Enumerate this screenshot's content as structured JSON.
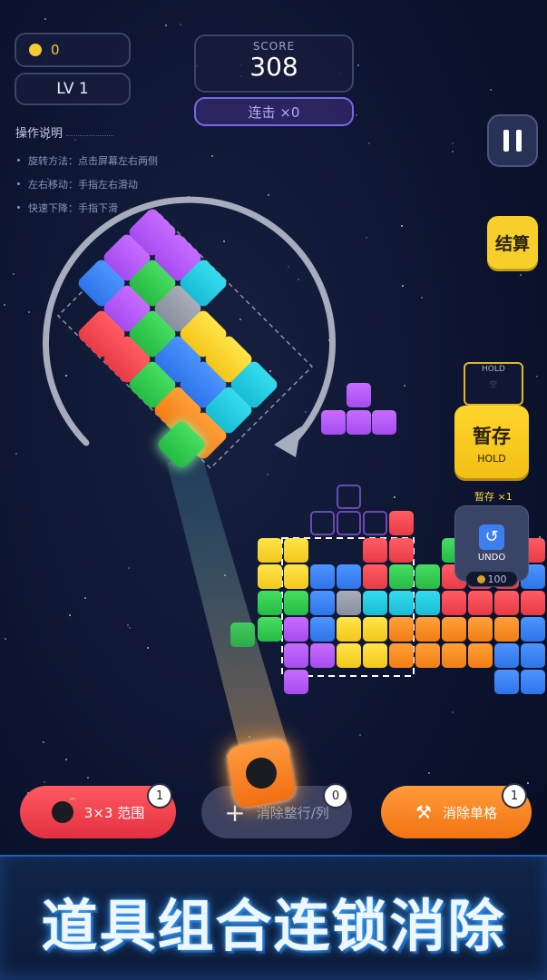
{
  "hud": {
    "coins": "0",
    "level": "LV 1",
    "score_label": "SCORE",
    "score": "308",
    "combo": "连击 ×0"
  },
  "instructions": {
    "title": "操作说明",
    "items": [
      "旋转方法：点击屏幕左右两侧",
      "左右移动：手指左右滑动",
      "快速下降：手指下滑"
    ]
  },
  "controls": {
    "pause_icon": "pause-icon",
    "settle_label": "结算",
    "hold_box_label": "HOLD",
    "hold_box_placeholder": "空",
    "hold_button_label": "暂存",
    "hold_button_sub": "HOLD",
    "hold_count": "暂存 ×1",
    "undo_label": "UNDO",
    "undo_cost": "100"
  },
  "tools": {
    "bomb": {
      "label": "3×3 范围",
      "count": "1"
    },
    "row_col": {
      "label": "消除整行/列",
      "count": "0"
    },
    "single": {
      "label": "消除单格",
      "count": "1"
    }
  },
  "banner": "道具组合连锁消除",
  "colors": {
    "red": "#e93a45",
    "yellow": "#f4c61a",
    "green": "#25bb44",
    "blue": "#2f73e9",
    "cyan": "#19bcd3",
    "orange": "#f37d14",
    "purple": "#a54cf0",
    "accent": "#7a67e6"
  }
}
